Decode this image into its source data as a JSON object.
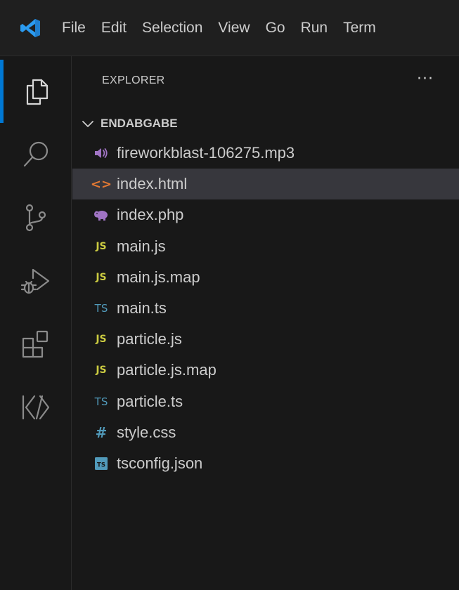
{
  "menu": [
    "File",
    "Edit",
    "Selection",
    "View",
    "Go",
    "Run",
    "Term"
  ],
  "activity_bar": {
    "items": [
      {
        "name": "explorer-icon",
        "active": true
      },
      {
        "name": "search-icon",
        "active": false
      },
      {
        "name": "source-control-icon",
        "active": false
      },
      {
        "name": "run-debug-icon",
        "active": false
      },
      {
        "name": "extensions-icon",
        "active": false
      },
      {
        "name": "remote-explorer-icon",
        "active": false
      }
    ]
  },
  "sidebar": {
    "title": "EXPLORER",
    "more": "···",
    "folder": "ENDABGABE",
    "files": [
      {
        "name": "fireworkblast-106275.mp3",
        "icon": "audio-icon",
        "selected": false
      },
      {
        "name": "index.html",
        "icon": "html-icon",
        "selected": true
      },
      {
        "name": "index.php",
        "icon": "php-icon",
        "selected": false
      },
      {
        "name": "main.js",
        "icon": "js-icon",
        "selected": false
      },
      {
        "name": "main.js.map",
        "icon": "js-icon",
        "selected": false
      },
      {
        "name": "main.ts",
        "icon": "ts-icon",
        "selected": false
      },
      {
        "name": "particle.js",
        "icon": "js-icon",
        "selected": false
      },
      {
        "name": "particle.js.map",
        "icon": "js-icon",
        "selected": false
      },
      {
        "name": "particle.ts",
        "icon": "ts-icon",
        "selected": false
      },
      {
        "name": "style.css",
        "icon": "css-icon",
        "selected": false
      },
      {
        "name": "tsconfig.json",
        "icon": "tsconfig-icon",
        "selected": false
      }
    ]
  },
  "icon_glyphs": {
    "js": "JS",
    "ts": "TS",
    "css": "#",
    "html": "<>"
  },
  "colors": {
    "accent": "#0078d4",
    "selection": "#37373d",
    "js": "#cbcb41",
    "ts": "#519aba",
    "html": "#e37933",
    "audio": "#a074c4",
    "php": "#a074c4"
  }
}
